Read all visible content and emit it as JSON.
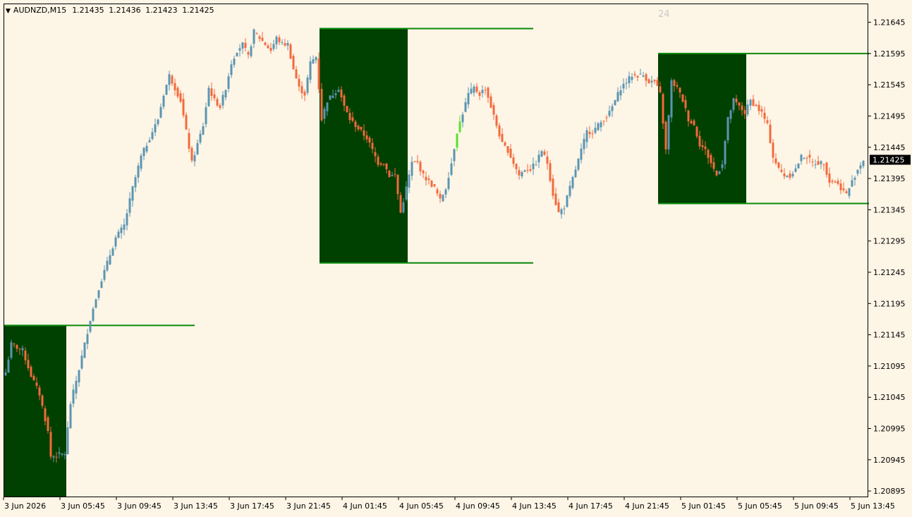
{
  "header": {
    "symbol": "AUDNZD,M15",
    "quotes": [
      "1.21435",
      "1.21436",
      "1.21423",
      "1.21425"
    ],
    "bar_counter": "24"
  },
  "colors": {
    "background": "#fdf5e6",
    "bull_candle": "#5b95b1",
    "bear_candle": "#f26a3d",
    "box_fill": "#004000",
    "box_line": "#0b8a0b",
    "highlight_candle": "#59e02a",
    "price_tag_bg": "#000000",
    "axis": "#000000"
  },
  "chart_data": {
    "type": "candlestick",
    "symbol": "AUDNZD",
    "timeframe": "M15",
    "current_price": 1.21425,
    "ylim": [
      1.20885,
      1.21675
    ],
    "yticks": [
      "1.21645",
      "1.21595",
      "1.21545",
      "1.21495",
      "1.21445",
      "1.21395",
      "1.21345",
      "1.21295",
      "1.21245",
      "1.21195",
      "1.21145",
      "1.21095",
      "1.21045",
      "1.20995",
      "1.20945",
      "1.20895"
    ],
    "xticks": [
      "3 Jun 2026",
      "3 Jun 05:45",
      "3 Jun 09:45",
      "3 Jun 13:45",
      "3 Jun 17:45",
      "3 Jun 21:45",
      "4 Jun 01:45",
      "4 Jun 05:45",
      "4 Jun 09:45",
      "4 Jun 13:45",
      "4 Jun 17:45",
      "4 Jun 21:45",
      "5 Jun 01:45",
      "5 Jun 05:45",
      "5 Jun 09:45",
      "5 Jun 13:45"
    ],
    "session_boxes": [
      {
        "start_bar": 0,
        "end_bar": 21,
        "line_end_bar": 67,
        "high": 1.2116,
        "low": 1.20885
      },
      {
        "start_bar": 112,
        "end_bar": 142,
        "line_end_bar": 187,
        "high": 1.21635,
        "low": 1.2126
      },
      {
        "start_bar": 232,
        "end_bar": 262,
        "line_end_bar": 306,
        "high": 1.21595,
        "low": 1.21355
      }
    ],
    "anchors": [
      [
        0,
        1.21085
      ],
      [
        2,
        1.2113
      ],
      [
        6,
        1.2112
      ],
      [
        9,
        1.2108
      ],
      [
        12,
        1.2105
      ],
      [
        15,
        1.2099
      ],
      [
        16,
        1.2095
      ],
      [
        21,
        1.20955
      ],
      [
        23,
        1.21035
      ],
      [
        26,
        1.2109
      ],
      [
        30,
        1.2117
      ],
      [
        33,
        1.2122
      ],
      [
        36,
        1.2126
      ],
      [
        39,
        1.213
      ],
      [
        42,
        1.2132
      ],
      [
        45,
        1.2138
      ],
      [
        48,
        1.2143
      ],
      [
        51,
        1.2146
      ],
      [
        54,
        1.2149
      ],
      [
        56,
        1.2153
      ],
      [
        58,
        1.2156
      ],
      [
        60,
        1.2154
      ],
      [
        62,
        1.2152
      ],
      [
        64,
        1.2147
      ],
      [
        66,
        1.2142
      ],
      [
        68,
        1.2145
      ],
      [
        70,
        1.2148
      ],
      [
        72,
        1.2154
      ],
      [
        74,
        1.2152
      ],
      [
        76,
        1.2151
      ],
      [
        78,
        1.2154
      ],
      [
        80,
        1.2158
      ],
      [
        82,
        1.216
      ],
      [
        84,
        1.2161
      ],
      [
        86,
        1.2159
      ],
      [
        88,
        1.2163
      ],
      [
        90,
        1.2162
      ],
      [
        92,
        1.2161
      ],
      [
        94,
        1.216
      ],
      [
        96,
        1.2162
      ],
      [
        98,
        1.2161
      ],
      [
        100,
        1.2161
      ],
      [
        102,
        1.2157
      ],
      [
        104,
        1.2154
      ],
      [
        106,
        1.2153
      ],
      [
        108,
        1.2158
      ],
      [
        110,
        1.2159
      ],
      [
        112,
        1.2149
      ],
      [
        114,
        1.2152
      ],
      [
        116,
        1.2153
      ],
      [
        118,
        1.2154
      ],
      [
        120,
        1.2151
      ],
      [
        122,
        1.2149
      ],
      [
        124,
        1.2148
      ],
      [
        126,
        1.2147
      ],
      [
        128,
        1.2146
      ],
      [
        130,
        1.2144
      ],
      [
        132,
        1.2142
      ],
      [
        134,
        1.2142
      ],
      [
        136,
        1.214
      ],
      [
        138,
        1.214
      ],
      [
        140,
        1.2134
      ],
      [
        142,
        1.2138
      ],
      [
        144,
        1.2142
      ],
      [
        146,
        1.2142
      ],
      [
        148,
        1.214
      ],
      [
        150,
        1.2139
      ],
      [
        152,
        1.2138
      ],
      [
        154,
        1.2136
      ],
      [
        156,
        1.2138
      ],
      [
        158,
        1.2142
      ],
      [
        160,
        1.2147
      ],
      [
        162,
        1.215
      ],
      [
        164,
        1.2153
      ],
      [
        166,
        1.2154
      ],
      [
        168,
        1.2153
      ],
      [
        170,
        1.2154
      ],
      [
        172,
        1.2151
      ],
      [
        174,
        1.2148
      ],
      [
        176,
        1.2145
      ],
      [
        178,
        1.2144
      ],
      [
        180,
        1.2142
      ],
      [
        182,
        1.214
      ],
      [
        184,
        1.2141
      ],
      [
        186,
        1.2141
      ],
      [
        188,
        1.2142
      ],
      [
        190,
        1.2144
      ],
      [
        192,
        1.2142
      ],
      [
        194,
        1.2137
      ],
      [
        196,
        1.2134
      ],
      [
        198,
        1.2135
      ],
      [
        200,
        1.2138
      ],
      [
        202,
        1.2141
      ],
      [
        204,
        1.2144
      ],
      [
        206,
        1.2147
      ],
      [
        208,
        1.2147
      ],
      [
        210,
        1.2148
      ],
      [
        212,
        1.2149
      ],
      [
        214,
        1.215
      ],
      [
        216,
        1.2152
      ],
      [
        218,
        1.2154
      ],
      [
        220,
        1.2155
      ],
      [
        222,
        1.2156
      ],
      [
        224,
        1.2156
      ],
      [
        226,
        1.2156
      ],
      [
        228,
        1.2155
      ],
      [
        230,
        1.2155
      ],
      [
        232,
        1.2153
      ],
      [
        234,
        1.2144
      ],
      [
        236,
        1.2155
      ],
      [
        238,
        1.2154
      ],
      [
        240,
        1.2152
      ],
      [
        242,
        1.2149
      ],
      [
        244,
        1.2148
      ],
      [
        246,
        1.2145
      ],
      [
        248,
        1.2144
      ],
      [
        250,
        1.2142
      ],
      [
        252,
        1.214
      ],
      [
        254,
        1.2142
      ],
      [
        256,
        1.2149
      ],
      [
        258,
        1.2152
      ],
      [
        260,
        1.2151
      ],
      [
        262,
        1.215
      ],
      [
        264,
        1.2152
      ],
      [
        266,
        1.2151
      ],
      [
        268,
        1.215
      ],
      [
        270,
        1.2148
      ],
      [
        272,
        1.2143
      ],
      [
        274,
        1.2141
      ],
      [
        276,
        1.214
      ],
      [
        278,
        1.214
      ],
      [
        280,
        1.2141
      ],
      [
        282,
        1.2143
      ],
      [
        284,
        1.2143
      ],
      [
        286,
        1.2142
      ],
      [
        288,
        1.2142
      ],
      [
        290,
        1.2142
      ],
      [
        292,
        1.2139
      ],
      [
        294,
        1.2139
      ],
      [
        296,
        1.2138
      ],
      [
        298,
        1.2137
      ],
      [
        300,
        1.2139
      ],
      [
        302,
        1.2141
      ],
      [
        304,
        1.21425
      ]
    ]
  }
}
